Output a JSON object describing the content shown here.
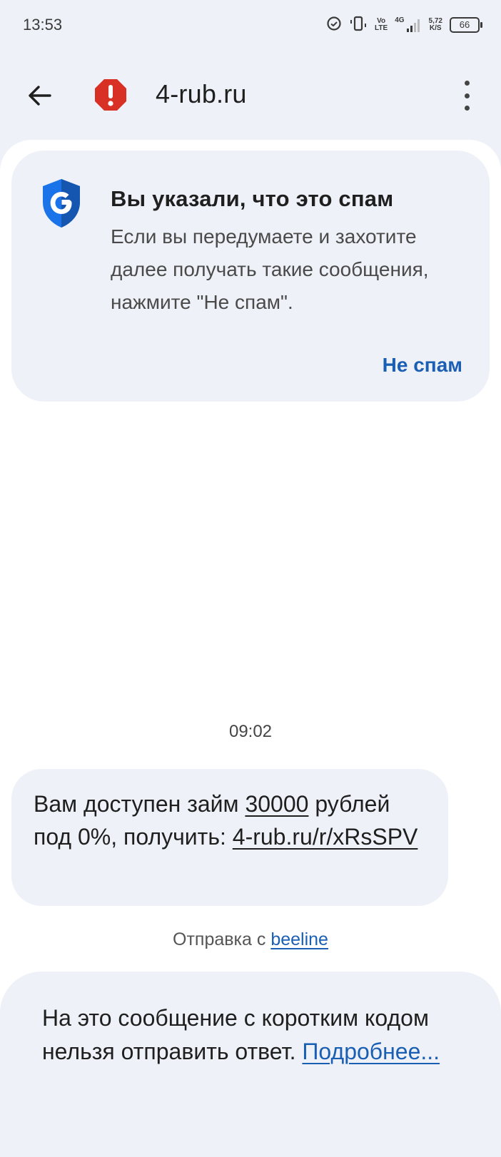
{
  "status_bar": {
    "time": "13:53",
    "vo_lte_top": "Vo",
    "vo_lte_bottom": "LTE",
    "network_type": "4G",
    "speed_top": "5,72",
    "speed_bottom": "K/S",
    "battery_level": "66"
  },
  "app_bar": {
    "title": "4-rub.ru"
  },
  "spam_card": {
    "heading": "Вы указали, что это спам",
    "body": "Если вы передумаете и захотите далее получать такие сообщения, нажмите \"Не спам\".",
    "not_spam_button": "Не спам"
  },
  "conversation": {
    "time": "09:02",
    "message": {
      "part1": "Вам доступен займ ",
      "amount": "30000",
      "part2": " рублей под 0%, получить: ",
      "link": "4-rub.ru/r/xRsSPV"
    },
    "sent_via_label": "Отправка с ",
    "sent_via_link": "beeline"
  },
  "reply_notice": {
    "text": "На это сообщение с коротким кодом нельзя отправить ответ. ",
    "link": "Подробнее..."
  },
  "colors": {
    "accent": "#1a5fb4",
    "spam_red": "#d93025",
    "shield_blue": "#1a73e8",
    "background": "#eef1f7"
  }
}
